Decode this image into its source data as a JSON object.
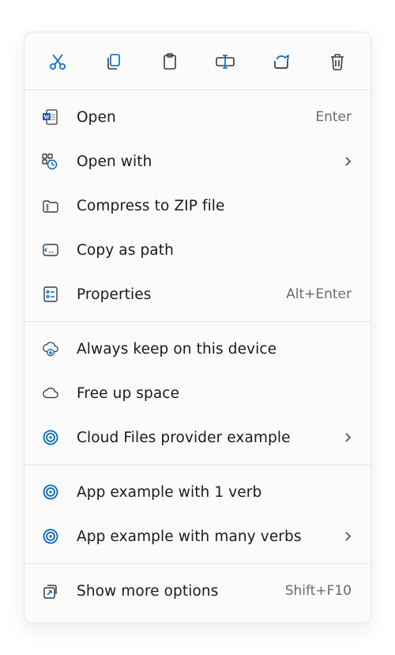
{
  "toolbar": [
    {
      "name": "cut-icon",
      "accent": true
    },
    {
      "name": "copy-icon",
      "accent": true
    },
    {
      "name": "paste-icon",
      "accent": false
    },
    {
      "name": "rename-icon",
      "accent": true
    },
    {
      "name": "share-icon",
      "accent": true
    },
    {
      "name": "delete-icon",
      "accent": false
    }
  ],
  "sections": [
    {
      "items": [
        {
          "icon": "word-doc-icon",
          "label": "Open",
          "shortcut": "Enter",
          "submenu": false
        },
        {
          "icon": "open-with-icon",
          "label": "Open with",
          "shortcut": null,
          "submenu": true
        },
        {
          "icon": "zip-icon",
          "label": "Compress to ZIP file",
          "shortcut": null,
          "submenu": false
        },
        {
          "icon": "copy-path-icon",
          "label": "Copy as path",
          "shortcut": null,
          "submenu": false
        },
        {
          "icon": "properties-icon",
          "label": "Properties",
          "shortcut": "Alt+Enter",
          "submenu": false
        }
      ]
    },
    {
      "items": [
        {
          "icon": "cloud-keep-icon",
          "label": "Always keep on this device",
          "shortcut": null,
          "submenu": false
        },
        {
          "icon": "cloud-free-icon",
          "label": "Free up space",
          "shortcut": null,
          "submenu": false
        },
        {
          "icon": "swirl-icon",
          "label": "Cloud Files provider example",
          "shortcut": null,
          "submenu": true
        }
      ]
    },
    {
      "items": [
        {
          "icon": "swirl-icon",
          "label": "App example with 1 verb",
          "shortcut": null,
          "submenu": false
        },
        {
          "icon": "swirl-icon",
          "label": "App example with many verbs",
          "shortcut": null,
          "submenu": true
        }
      ]
    },
    {
      "items": [
        {
          "icon": "more-options-icon",
          "label": "Show more options",
          "shortcut": "Shift+F10",
          "submenu": false
        }
      ]
    }
  ],
  "colors": {
    "accent": "#0067C0",
    "dark": "#3a3a3a"
  }
}
